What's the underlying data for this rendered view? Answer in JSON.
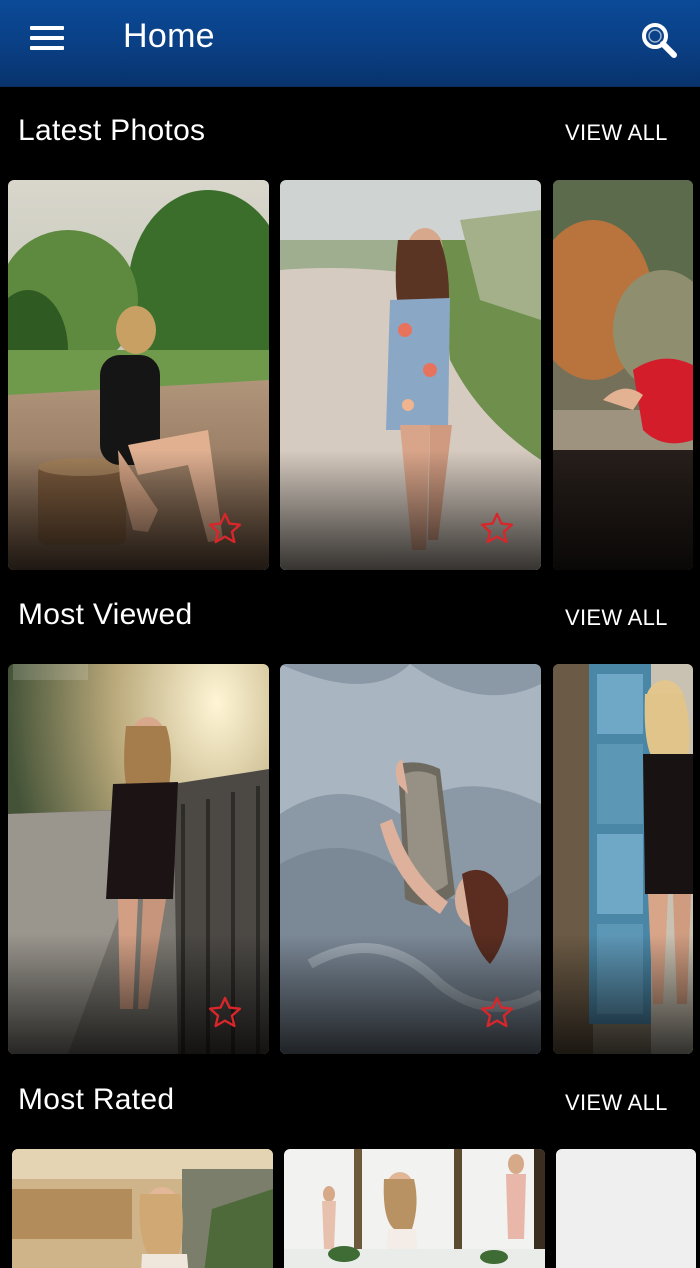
{
  "app_bar": {
    "title": "Home"
  },
  "sections": [
    {
      "title": "Latest Photos",
      "view_all": "VIEW ALL"
    },
    {
      "title": "Most Viewed",
      "view_all": "VIEW ALL"
    },
    {
      "title": "Most Rated",
      "view_all": "VIEW ALL"
    }
  ],
  "icons": {
    "menu": "menu-icon",
    "search": "search-icon",
    "favorite": "star-outline-icon"
  },
  "colors": {
    "app_bar": "#0a3f84",
    "background": "#000000",
    "favorite_star": "#d8262b"
  }
}
